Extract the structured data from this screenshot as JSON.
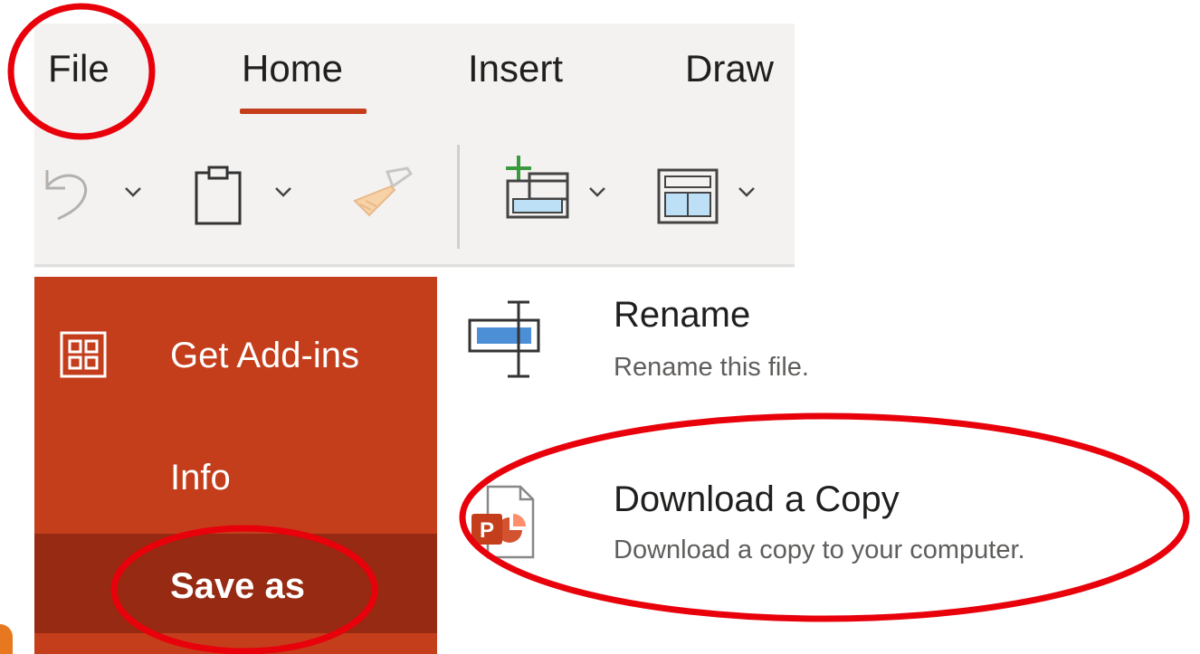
{
  "ribbon": {
    "tabs": {
      "file": "File",
      "home": "Home",
      "insert": "Insert",
      "draw": "Draw"
    },
    "active_tab": "Home",
    "active_color": "#c43e1c",
    "toolbar": [
      {
        "name": "undo-icon"
      },
      {
        "name": "dropdown-chevron-icon"
      },
      {
        "name": "paste-icon"
      },
      {
        "name": "dropdown-chevron-icon"
      },
      {
        "name": "format-painter-icon"
      },
      {
        "name": "new-slide-icon"
      },
      {
        "name": "dropdown-chevron-icon"
      },
      {
        "name": "layout-icon"
      },
      {
        "name": "dropdown-chevron-icon"
      }
    ]
  },
  "file_menu": {
    "background": "#c43e1c",
    "selected_background": "#962a12",
    "items": [
      {
        "label": "Get Add-ins",
        "icon": "add-ins-icon"
      },
      {
        "label": "Info"
      },
      {
        "label": "Save as",
        "selected": true
      }
    ]
  },
  "actions": [
    {
      "title": "Rename",
      "description": "Rename this file.",
      "icon": "rename-icon"
    },
    {
      "title": "Download a Copy",
      "description": "Download a copy to your computer.",
      "icon": "powerpoint-file-icon"
    }
  ],
  "annotation_color": "#e8000b"
}
